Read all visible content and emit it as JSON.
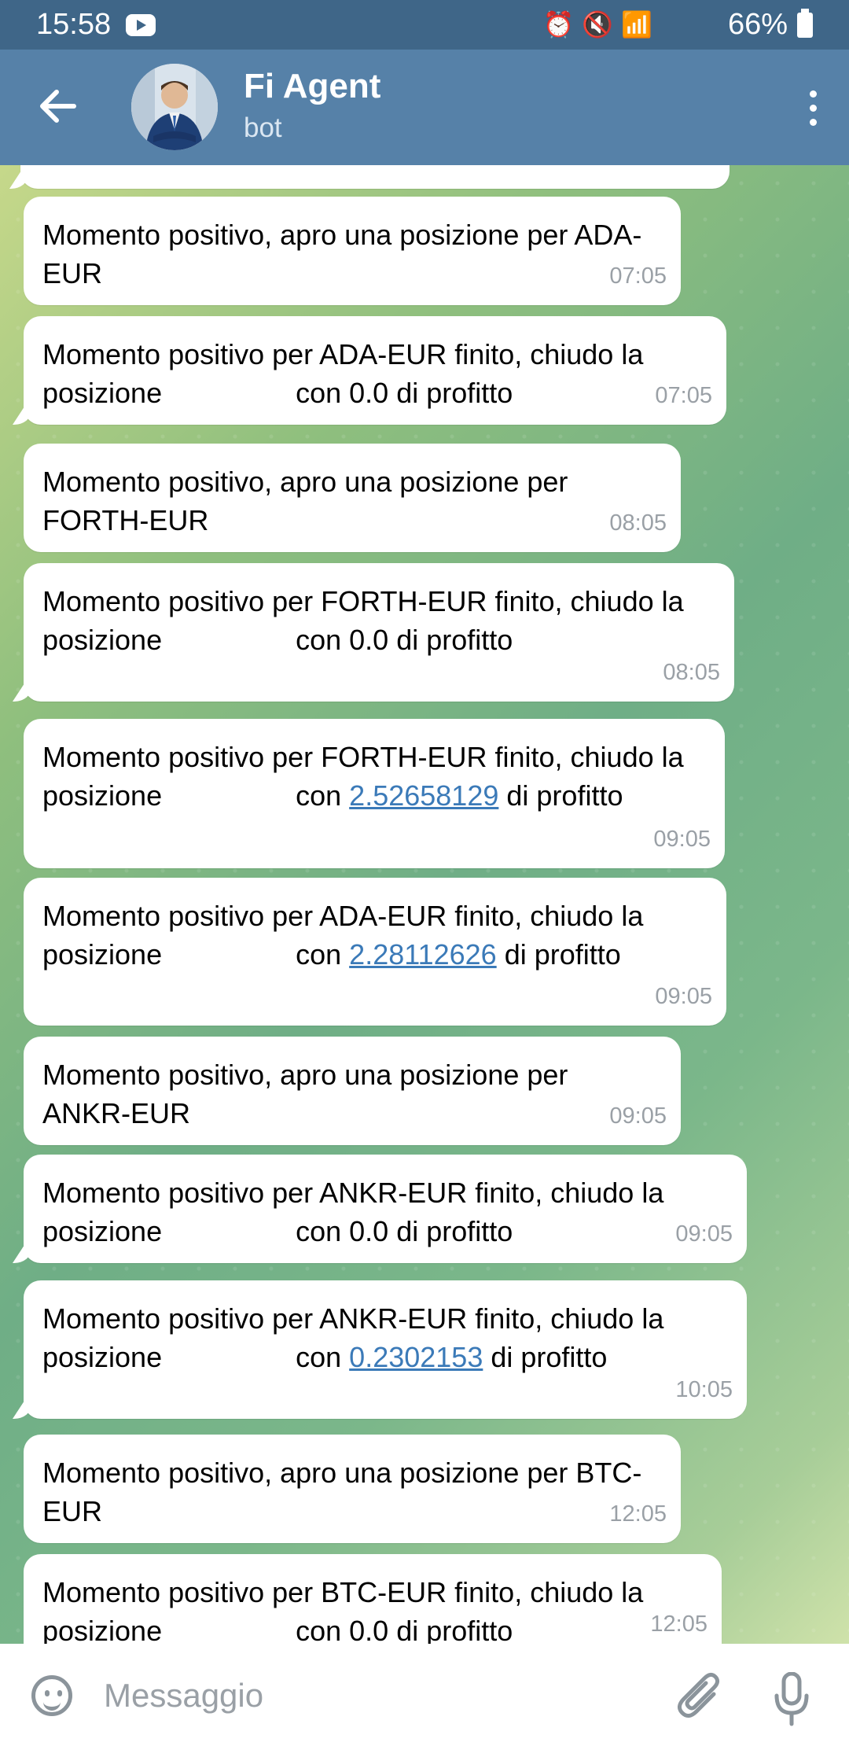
{
  "status_bar": {
    "time": "15:58",
    "battery": "66%"
  },
  "header": {
    "title": "Fi Agent",
    "subtitle": "bot"
  },
  "messages": [
    {
      "text": "Momento positivo, apro una posizione per ADA-EUR",
      "time": "07:05"
    },
    {
      "text_a": "Momento positivo per ADA-EUR finito, chiudo la posizione",
      "text_b": "con 0.0 di profitto",
      "time": "07:05"
    },
    {
      "text": "Momento positivo, apro una posizione per FORTH-EUR",
      "time": "08:05"
    },
    {
      "text_a": "Momento positivo per FORTH-EUR finito, chiudo la posizione",
      "text_b": "con 0.0 di profitto",
      "time": "08:05"
    },
    {
      "text_a": "Momento positivo per FORTH-EUR finito, chiudo la posizione",
      "text_b": "con",
      "link": "2.52658129",
      "text_c": "di profitto",
      "time": "09:05"
    },
    {
      "text_a": "Momento positivo per ADA-EUR finito, chiudo la posizione",
      "text_b": "con",
      "link": "2.28112626",
      "text_c": "di profitto",
      "time": "09:05"
    },
    {
      "text": "Momento positivo, apro una posizione per ANKR-EUR",
      "time": "09:05"
    },
    {
      "text_a": "Momento positivo per ANKR-EUR finito, chiudo la posizione",
      "text_b": "con 0.0 di profitto",
      "time": "09:05"
    },
    {
      "text_a": "Momento positivo per ANKR-EUR finito, chiudo la posizione",
      "text_b": "con",
      "link": "0.2302153",
      "text_c": "di profitto",
      "time": "10:05"
    },
    {
      "text": "Momento positivo, apro una posizione per BTC-EUR",
      "time": "12:05"
    },
    {
      "text_a": "Momento positivo per BTC-EUR finito, chiudo la posizione",
      "text_b": "con 0.0 di profitto",
      "time": "12:05"
    }
  ],
  "input": {
    "placeholder": "Messaggio"
  },
  "colors": {
    "header": "#5681a8",
    "status_bar": "#3f6688",
    "link": "#3b7ab8"
  }
}
